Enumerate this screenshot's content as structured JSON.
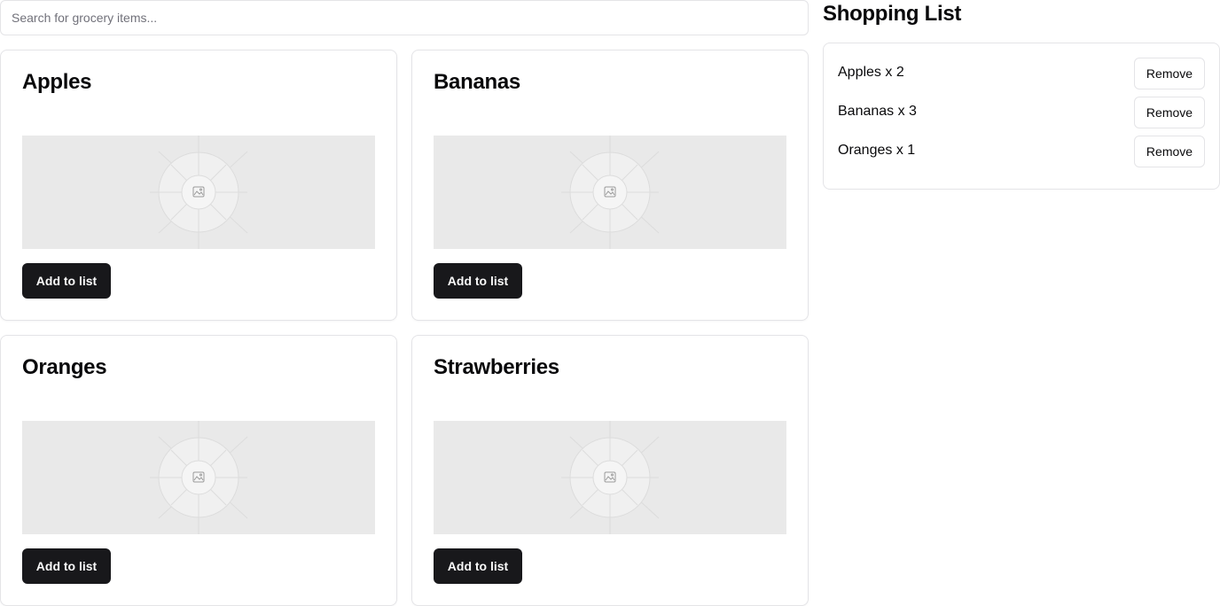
{
  "search": {
    "placeholder": "Search for grocery items...",
    "value": ""
  },
  "products": [
    {
      "name": "Apples",
      "button_label": "Add to list",
      "image_icon": "image-placeholder-icon"
    },
    {
      "name": "Bananas",
      "button_label": "Add to list",
      "image_icon": "image-placeholder-icon"
    },
    {
      "name": "Oranges",
      "button_label": "Add to list",
      "image_icon": "image-placeholder-icon"
    },
    {
      "name": "Strawberries",
      "button_label": "Add to list",
      "image_icon": "image-placeholder-icon"
    }
  ],
  "shopping_list": {
    "title": "Shopping List",
    "items": [
      {
        "text": "Apples x 2",
        "button_label": "Remove"
      },
      {
        "text": "Bananas x 3",
        "button_label": "Remove"
      },
      {
        "text": "Oranges x 1",
        "button_label": "Remove"
      }
    ]
  },
  "colors": {
    "primary_button": "#18181b",
    "border": "#e4e4e7",
    "placeholder_bg": "#e9e9e9"
  }
}
